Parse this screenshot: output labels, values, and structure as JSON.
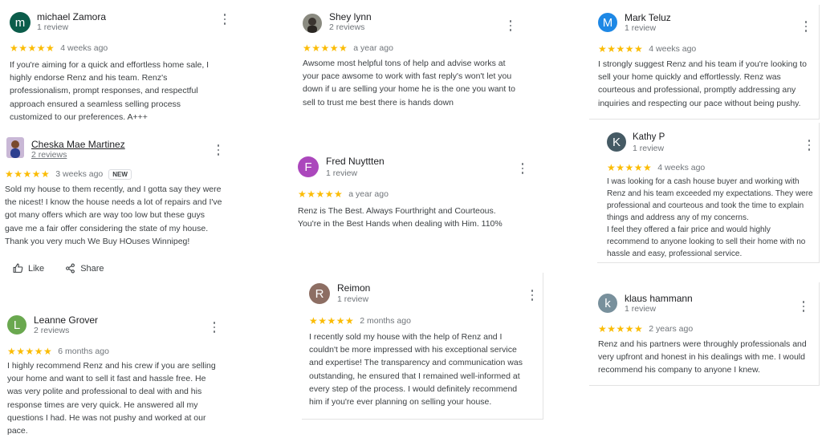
{
  "colors": {
    "star": "#fbbc04",
    "text": "#3c4043",
    "meta": "#70757a"
  },
  "reviews": [
    {
      "name": "michael Zamora",
      "sub": "1 review",
      "avatar_letter": "m",
      "avatar_color": "#0b5c4a",
      "stars": "★★★★★",
      "when": "4 weeks ago",
      "lines": [
        "If you're aiming for a quick and effortless home sale, I",
        "highly endorse Renz and his team. Renz's",
        "professionalism, prompt responses, and respectful",
        "approach ensured a seamless selling process",
        "customized to our preferences. A+++"
      ]
    },
    {
      "name": "Cheska Mae Martinez",
      "sub": "2 reviews",
      "avatar_icon": "profile-photo",
      "stars": "★★★★★",
      "when": "3 weeks ago",
      "badge": "NEW",
      "lines": [
        "Sold my house to them recently, and I gotta say they were",
        "the nicest! I know the house needs a lot of repairs and I've",
        "got many offers which are way  too low but these guys",
        "gave me a fair offer considering the state of my house.",
        "Thank you very much We Buy HOuses Winnipeg!"
      ],
      "like": "Like",
      "share": "Share"
    },
    {
      "name": "Leanne Grover",
      "sub": "2 reviews",
      "avatar_letter": "L",
      "avatar_color": "#6aa84f",
      "stars": "★★★★★",
      "when": "6 months ago",
      "lines": [
        "I highly recommend Renz and his crew if you are selling",
        "your home and want to sell it  fast and hassle free.  He",
        "was very polite and professional to deal with and his",
        "response times are very quick.  He answered all my",
        "questions I had.  He was not pushy and worked at our",
        "pace."
      ]
    },
    {
      "name": "Shey lynn",
      "sub": "2 reviews",
      "avatar_icon": "profile-photo",
      "stars": "★★★★★",
      "when": "a year ago",
      "lines": [
        "Awsome most helpful tons of help and advise works at",
        "your pace awsome to work with fast reply's won't let you",
        "down if u are selling your home he is the one you want to",
        "sell to trust me best there is hands down"
      ]
    },
    {
      "name": "Fred Nuyttten",
      "sub": "1 review",
      "avatar_letter": "F",
      "avatar_color": "#ab47bc",
      "stars": "★★★★★",
      "when": "a year ago",
      "lines": [
        "Renz is The Best. Always Fourthright and Courteous.",
        "You're in the Best Hands when dealing with Him. 110%"
      ]
    },
    {
      "name": "Reimon",
      "sub": "1 review",
      "avatar_letter": "R",
      "avatar_color": "#8d6e63",
      "stars": "★★★★★",
      "when": "2 months ago",
      "lines": [
        "I recently sold my house with the help of Renz and I",
        "couldn't be more impressed with his exceptional service",
        "and expertise! The transparency and communication was",
        "outstanding, he ensured that I remained well-informed at",
        "every step of the process. I would definitely recommend",
        "him if you're ever planning on selling your house."
      ]
    },
    {
      "name": "Mark Teluz",
      "sub": "1 review",
      "avatar_letter": "M",
      "avatar_color": "#1e88e5",
      "stars": "★★★★★",
      "when": "4 weeks ago",
      "lines": [
        "I strongly suggest Renz and his team if you're looking to",
        "sell your home quickly and effortlessly. Renz was",
        "courteous and professional, promptly addressing any",
        "inquiries and respecting our pace without being pushy."
      ]
    },
    {
      "name": "Kathy P",
      "sub": "1 review",
      "avatar_letter": "K",
      "avatar_color": "#455a64",
      "stars": "★★★★★",
      "when": "4 weeks ago",
      "lines": [
        "I was looking for a cash house buyer and working with",
        "Renz and his team exceeded my expectations. They were",
        "professional and courteous and took the time to explain",
        "things and address any of my concerns.",
        "I feel they offered a fair price and would highly",
        "recommend to anyone looking to sell their home with no",
        "hassle and easy, professional service."
      ]
    },
    {
      "name": "klaus hammann",
      "sub": "1 review",
      "avatar_letter": "k",
      "avatar_color": "#78909c",
      "stars": "★★★★★",
      "when": "2 years ago",
      "lines": [
        "Renz and his partners were throughly professionals and",
        "very upfront and honest in his dealings with me.  I would",
        "recommend his company to anyone I knew."
      ]
    }
  ]
}
